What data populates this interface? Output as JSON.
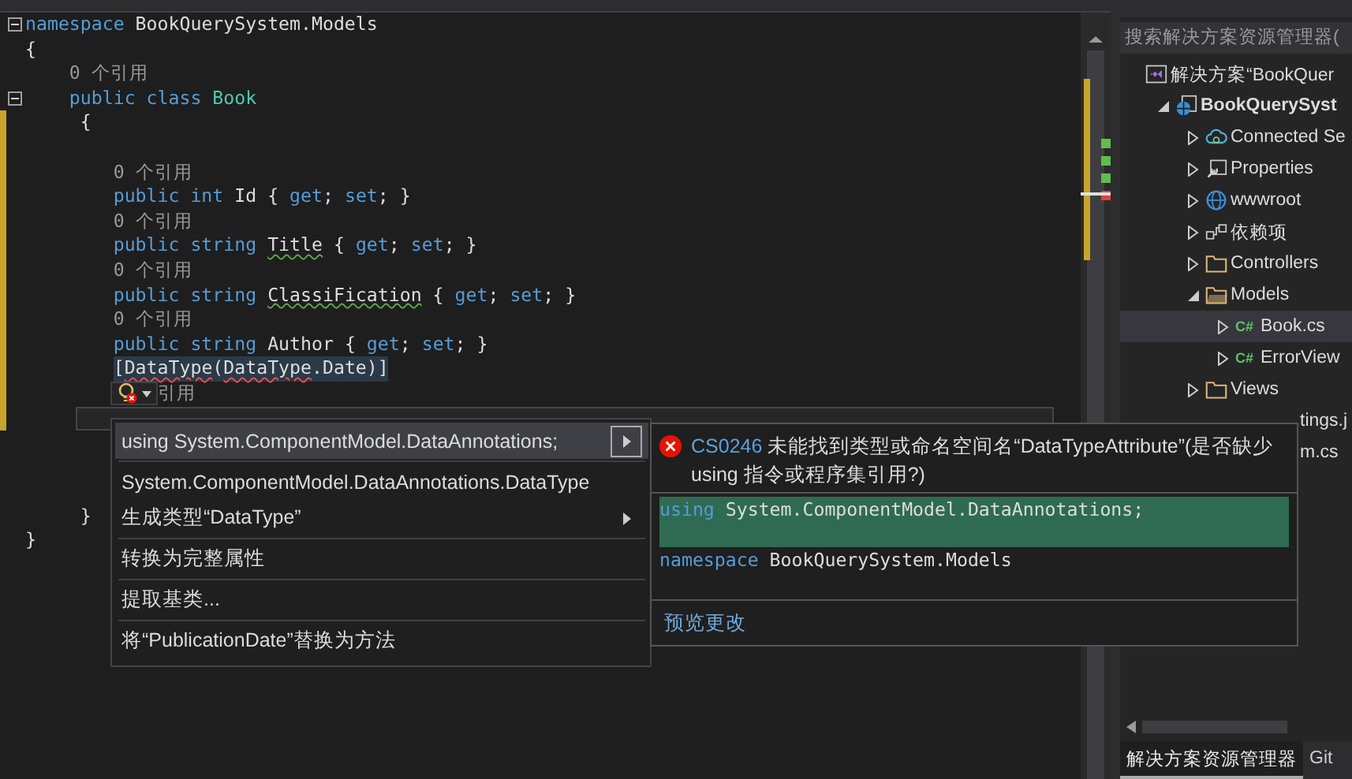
{
  "editor": {
    "lines": [
      {
        "kind": "code",
        "changed": false,
        "collapsible": true,
        "tokens": [
          {
            "text": "namespace",
            "kind": "keyword"
          },
          {
            "text": " BookQuerySystem.Models",
            "kind": "plain"
          }
        ]
      },
      {
        "kind": "code",
        "changed": false,
        "tokens": [
          {
            "text": "{",
            "kind": "plain"
          }
        ]
      },
      {
        "kind": "code",
        "changed": false,
        "tokens": [
          {
            "text": "    0 个引用",
            "kind": "lens"
          }
        ]
      },
      {
        "kind": "code",
        "changed": false,
        "collapsible": true,
        "tokens": [
          {
            "text": "    public class ",
            "kind": "keyword"
          },
          {
            "text": "Book",
            "kind": "type"
          }
        ]
      },
      {
        "kind": "code",
        "changed": true,
        "tokens": [
          {
            "text": "     {",
            "kind": "plain"
          }
        ]
      },
      {
        "kind": "blank",
        "changed": true
      },
      {
        "kind": "code",
        "changed": true,
        "tokens": [
          {
            "text": "        0 个引用",
            "kind": "lens"
          }
        ]
      },
      {
        "kind": "code",
        "changed": true,
        "tokens": [
          {
            "text": "        public int",
            "kind": "keyword"
          },
          {
            "text": " Id { ",
            "kind": "plain"
          },
          {
            "text": "get",
            "kind": "keyword"
          },
          {
            "text": "; ",
            "kind": "plain"
          },
          {
            "text": "set",
            "kind": "keyword"
          },
          {
            "text": "; }",
            "kind": "plain"
          }
        ]
      },
      {
        "kind": "code",
        "changed": true,
        "tokens": [
          {
            "text": "        0 个引用",
            "kind": "lens"
          }
        ]
      },
      {
        "kind": "code",
        "changed": true,
        "tokens": [
          {
            "text": "        public string ",
            "kind": "keyword"
          },
          {
            "text": "Title",
            "kind": "plain",
            "warning": true
          },
          {
            "text": " { ",
            "kind": "plain"
          },
          {
            "text": "get",
            "kind": "keyword"
          },
          {
            "text": "; ",
            "kind": "plain"
          },
          {
            "text": "set",
            "kind": "keyword"
          },
          {
            "text": "; }",
            "kind": "plain"
          }
        ]
      },
      {
        "kind": "code",
        "changed": true,
        "tokens": [
          {
            "text": "        0 个引用",
            "kind": "lens"
          }
        ]
      },
      {
        "kind": "code",
        "changed": true,
        "tokens": [
          {
            "text": "        public string ",
            "kind": "keyword"
          },
          {
            "text": "ClassiFication",
            "kind": "plain",
            "warning": true
          },
          {
            "text": " { ",
            "kind": "plain"
          },
          {
            "text": "get",
            "kind": "keyword"
          },
          {
            "text": "; ",
            "kind": "plain"
          },
          {
            "text": "set",
            "kind": "keyword"
          },
          {
            "text": "; }",
            "kind": "plain"
          }
        ]
      },
      {
        "kind": "code",
        "changed": true,
        "tokens": [
          {
            "text": "        0 个引用",
            "kind": "lens"
          }
        ]
      },
      {
        "kind": "code",
        "changed": true,
        "tokens": [
          {
            "text": "        public string ",
            "kind": "keyword"
          },
          {
            "text": "Author",
            "kind": "plain"
          },
          {
            "text": " { ",
            "kind": "plain"
          },
          {
            "text": "get",
            "kind": "keyword"
          },
          {
            "text": "; ",
            "kind": "plain"
          },
          {
            "text": "set",
            "kind": "keyword"
          },
          {
            "text": "; }",
            "kind": "plain"
          }
        ]
      },
      {
        "kind": "code",
        "changed": true,
        "highlight": true,
        "tokens": [
          {
            "text": "        [",
            "kind": "plain"
          },
          {
            "text": "DataType",
            "kind": "plain",
            "error": true
          },
          {
            "text": "(",
            "kind": "plain"
          },
          {
            "text": "DataType",
            "kind": "plain",
            "error": true
          },
          {
            "text": ".Date)]",
            "kind": "plain"
          }
        ]
      },
      {
        "kind": "bulb",
        "changed": true,
        "tokens": [
          {
            "text": "引用",
            "kind": "lens"
          }
        ]
      },
      {
        "kind": "blank",
        "changed": true,
        "current": true
      },
      {
        "kind": "blank",
        "changed": false
      },
      {
        "kind": "blank",
        "changed": false
      },
      {
        "kind": "blank",
        "changed": false
      },
      {
        "kind": "code",
        "changed": false,
        "tokens": [
          {
            "text": "     }",
            "kind": "plain"
          }
        ]
      },
      {
        "kind": "code",
        "changed": false,
        "tokens": [
          {
            "text": "}",
            "kind": "plain"
          }
        ]
      }
    ]
  },
  "quick_actions": {
    "items": [
      {
        "label": "using System.ComponentModel.DataAnnotations;",
        "selected": true,
        "submenu": true,
        "separator_before": false
      },
      {
        "label": "System.ComponentModel.DataAnnotations.DataType",
        "selected": false,
        "submenu": false,
        "separator_before": true
      },
      {
        "label": "生成类型“DataType”",
        "selected": false,
        "submenu": true,
        "separator_before": false
      },
      {
        "label": "转换为完整属性",
        "selected": false,
        "submenu": false,
        "separator_before": true
      },
      {
        "label": "提取基类...",
        "selected": false,
        "submenu": false,
        "separator_before": true
      },
      {
        "label": "将“PublicationDate”替换为方法",
        "selected": false,
        "submenu": false,
        "separator_before": true
      }
    ]
  },
  "preview": {
    "error_code": "CS0246",
    "message": "未能找到类型或命名空间名“DataTypeAttribute”(是否缺少 using 指令或程序集引用?)",
    "diff": [
      {
        "added": true,
        "tokens": [
          {
            "text": "using",
            "kind": "keyword"
          },
          {
            "text": " System.ComponentModel.DataAnnotations;",
            "kind": "plain"
          }
        ]
      },
      {
        "added": false,
        "tokens": [
          {
            "text": "namespace",
            "kind": "keyword"
          },
          {
            "text": " BookQuerySystem.Models",
            "kind": "plain"
          }
        ]
      }
    ],
    "link": "预览更改"
  },
  "solution_explorer": {
    "search": {
      "placeholder": "搜索解决方案资源管理器("
    },
    "tree": [
      {
        "label": "解决方案“BookQuer",
        "kind": "solution",
        "selected": false,
        "children": [
          {
            "label": "BookQuerySyst",
            "kind": "project",
            "expanded": true,
            "selected": false,
            "children": [
              {
                "label": "Connected Se",
                "kind": "service",
                "expanded": false,
                "selected": false
              },
              {
                "label": "Properties",
                "kind": "properties",
                "expanded": false,
                "selected": false
              },
              {
                "label": "wwwroot",
                "kind": "web",
                "expanded": false,
                "selected": false
              },
              {
                "label": "依赖项",
                "kind": "dependencies",
                "expanded": false,
                "selected": false
              },
              {
                "label": "Controllers",
                "kind": "folder",
                "expanded": false,
                "selected": false
              },
              {
                "label": "Models",
                "kind": "folder",
                "expanded": true,
                "selected": false,
                "children": [
                  {
                    "label": "Book.cs",
                    "kind": "csharp",
                    "badge": "C#",
                    "expanded": false,
                    "selected": true
                  },
                  {
                    "label": "ErrorView",
                    "kind": "csharp",
                    "badge": "C#",
                    "expanded": false,
                    "selected": false
                  }
                ]
              },
              {
                "label": "Views",
                "kind": "folder",
                "expanded": false,
                "selected": false
              },
              {
                "label": "tings.j",
                "kind": "covered",
                "selected": false
              },
              {
                "label": "m.cs",
                "kind": "covered",
                "selected": false
              }
            ]
          }
        ]
      }
    ],
    "tabs": [
      {
        "label": "解决方案资源管理器",
        "selected": true
      },
      {
        "label": "Git",
        "selected": false
      }
    ]
  }
}
